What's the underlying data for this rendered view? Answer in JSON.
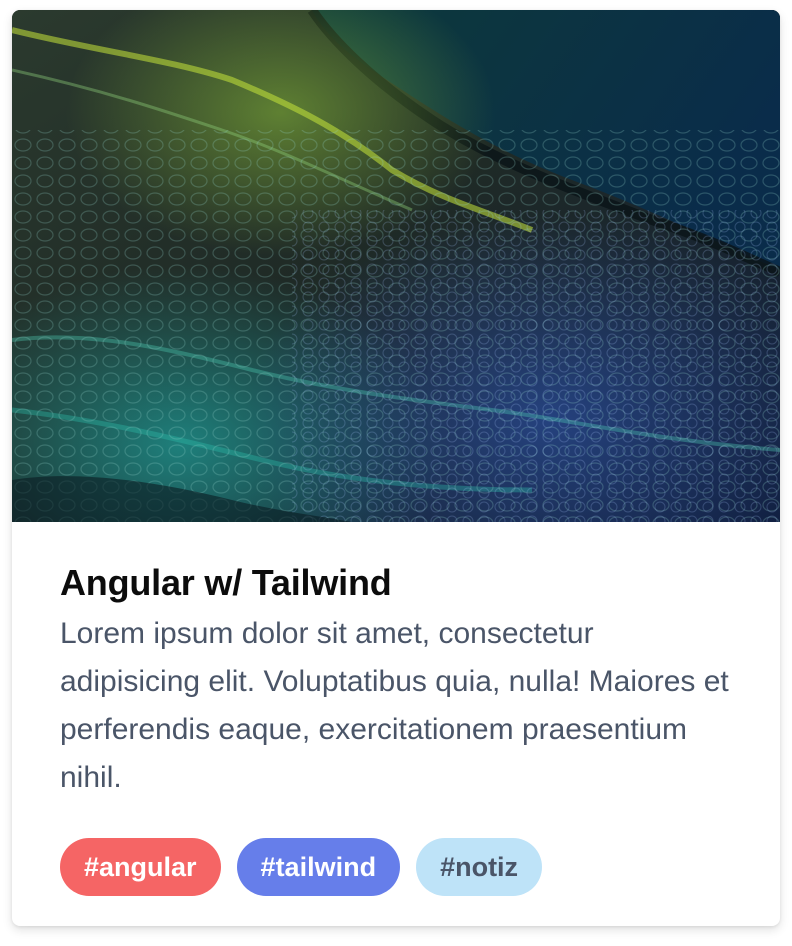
{
  "card": {
    "image_alt": "abstract acrylic pour painting in green and blue",
    "title": "Angular w/ Tailwind",
    "description": "Lorem ipsum dolor sit amet, consectetur adipisicing elit. Voluptatibus quia, nulla! Maiores et perferendis eaque, exercitationem praesentium nihil.",
    "tags": [
      {
        "label": "#angular",
        "color": "#f56565"
      },
      {
        "label": "#tailwind",
        "color": "#667eea"
      },
      {
        "label": "#notiz",
        "color": "#bee3f8"
      }
    ]
  },
  "colors": {
    "title": "#0c0c0c",
    "body_text": "#4a5568",
    "card_bg": "#ffffff"
  }
}
